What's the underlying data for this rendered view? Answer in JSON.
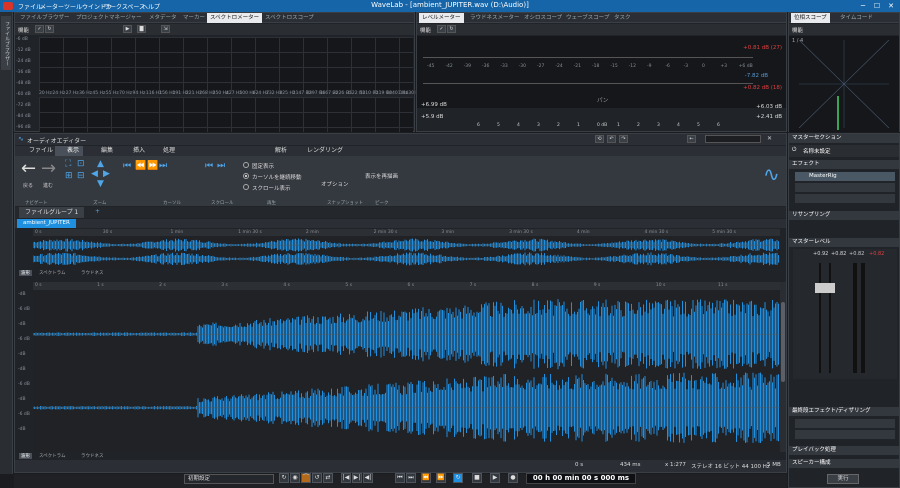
{
  "window": {
    "title": "WaveLab - [ambient_JUPITER.wav (D:\\Audio)]",
    "menu": [
      "ファイル",
      "メーター",
      "ツールウインドウ",
      "ワークスペース",
      "ヘルプ"
    ],
    "minimize": "─",
    "maximize": "☐",
    "close": "✕"
  },
  "left_strip": {
    "label": "ファイルブラウザー"
  },
  "top_left": {
    "tabs": [
      "ファイルブラウザー",
      "プロジェクトマネージャー",
      "メタデータ",
      "マーカー",
      "スペクトロメーター",
      "スペクトロスコープ"
    ],
    "active": 4,
    "toolbar_label": "機能",
    "freq_ticks": [
      "20 Hz",
      "24 Hz",
      "27 Hz",
      "36 Hz",
      "45 Hz",
      "55 Hz",
      "70 Hz",
      "94 Hz",
      "116 Hz",
      "156 Hz",
      "191 Hz",
      "221 Hz",
      "268 Hz",
      "350 Hz",
      "427 Hz",
      "500 Hz",
      "624 Hz",
      "732 Hz",
      "825 Hz",
      "1147 Hz",
      "1397 Hz",
      "1667 Hz",
      "2226 Hz",
      "3522 Hz",
      "5310 Hz",
      "7119 Hz",
      "10401 Hz",
      "16430 Hz"
    ],
    "db_ticks": [
      "-6 dB",
      "-12 dB",
      "-24 dB",
      "-36 dB",
      "-48 dB",
      "-60 dB",
      "-72 dB",
      "-84 dB",
      "-96 dB"
    ]
  },
  "top_mid": {
    "tabs": [
      "レベルメーター",
      "ラウドネスメーター",
      "オシロスコープ",
      "ウェーブスコープ",
      "タスク"
    ],
    "active": 0,
    "toolbar_label": "機能",
    "scale": [
      "-45",
      "-42",
      "-39",
      "-36",
      "-33",
      "-30",
      "-27",
      "-24",
      "-21",
      "-18",
      "-15",
      "-12",
      "-9",
      "-6",
      "-3",
      "0",
      "+3",
      "+6 dB"
    ],
    "peak_L": "+0.81 dB (27)",
    "rms_L": "-7.82 dB",
    "peak_R": "+0.82 dB (18)",
    "pan_label": "パン",
    "pan_scale": [
      "6",
      "5",
      "4",
      "3",
      "2",
      "1",
      "0 dB",
      "1",
      "2",
      "3",
      "4",
      "5",
      "6"
    ],
    "left_readout1": "+6.99 dB",
    "left_readout2": "+5.9 dB",
    "right_readout1": "+6.03 dB",
    "right_readout2": "+2.41 dB"
  },
  "top_right": {
    "tabs": [
      "位相スコープ",
      "タイムコード"
    ],
    "active": 0,
    "toolbar_label": "機能",
    "ratio": "1 / 4"
  },
  "audio_editor": {
    "title": "オーディオエディター",
    "ribbon_tabs": [
      "ファイル",
      "表示",
      "編集",
      "挿入",
      "処理",
      "解析",
      "レンダリング"
    ],
    "active_tab": 1,
    "groups": [
      "ナビゲート",
      "ズーム",
      "カーソル",
      "スクロール",
      "再生",
      "スナップショット",
      "ピーク"
    ],
    "back_label": "戻る",
    "fwd_label": "進む",
    "opt1": "固定表示",
    "opt2": "カーソルを継続移動",
    "opt3": "スクロール表示",
    "options_label": "オプション",
    "redraw_label": "表示を再描画",
    "group_tab": "ファイルグループ 1",
    "file_tab": "ambient_JUPITER",
    "time_ticks": [
      "0 s",
      "30 s",
      "1 min",
      "1 min 30 s",
      "2 min",
      "2 min 30 s",
      "3 min",
      "3 min 30 s",
      "4 min",
      "4 min 30 s",
      "5 min 30 s"
    ],
    "detail_ticks": [
      "0 s",
      "1 s",
      "2 s",
      "3 s",
      "4 s",
      "5 s",
      "6 s",
      "7 s",
      "8 s",
      "9 s",
      "10 s",
      "11 s"
    ],
    "overview_mode_tabs": [
      "波形",
      "スペクトラム",
      "ラウドネス"
    ],
    "main_mode_tabs": [
      "波形",
      "スペクトラム",
      "ラウドネス"
    ],
    "db_labels": [
      "-dB",
      "-6 dB",
      "-dB",
      "-6 dB",
      "-dB",
      "-dB",
      "-6 dB",
      "-dB",
      "-6 dB",
      "-dB"
    ],
    "status": {
      "cursor": "0 s",
      "zoom": "434 ms",
      "ratio": "x 1:277",
      "format": "ステレオ 16 ビット 44 100 Hz",
      "size": "5 MB"
    }
  },
  "master": {
    "title": "マスターセクション",
    "preset_label": "名称未設定",
    "effects_label": "エフェクト",
    "slot1": "MasterRig",
    "resample_label": "リサンプリング",
    "level_label": "マスターレベル",
    "level_values": [
      "+0.92",
      "+0.82",
      "+0.82",
      "+0.82"
    ],
    "post_label": "最終段エフェクト/ディザリング",
    "playback_label": "プレイバック処理",
    "speaker_label": "スピーカー構成",
    "render_label": "実行"
  },
  "transport": {
    "preset": "初期設定",
    "time": "00 h 00 min 00 s 000 ms"
  }
}
